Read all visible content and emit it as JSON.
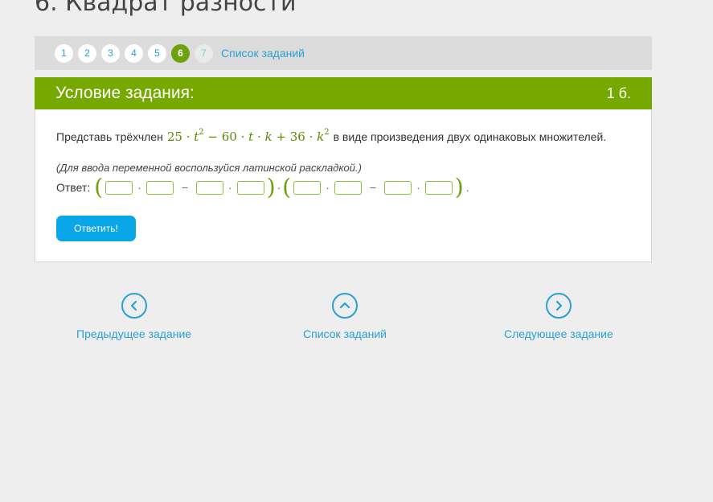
{
  "page": {
    "title": "6. Квадрат разности"
  },
  "pager": {
    "numbers": [
      "1",
      "2",
      "3",
      "4",
      "5",
      "6",
      "7"
    ],
    "active": "6",
    "list_link": "Список заданий"
  },
  "card": {
    "title": "Условие задания:",
    "points": "1 б.",
    "task_before": "Представь трёхчлен",
    "task_after": "в виде произведения двух одинаковых множителей.",
    "expression": {
      "c1": "25",
      "v1": "t",
      "e1": "2",
      "c2": "60",
      "v2": "t",
      "v3": "k",
      "c3": "36",
      "v4": "k",
      "e4": "2"
    },
    "hint": "(Для ввода переменной воспользуйся латинской раскладкой.)",
    "answer_label": "Ответ:",
    "submit_label": "Ответить!"
  },
  "navigation": {
    "prev": "Предыдущее задание",
    "list": "Список заданий",
    "next": "Следующее задание"
  },
  "colors": {
    "accent_green": "#76a900",
    "link_blue": "#2aa0d4",
    "button_blue": "#0aa7e8"
  }
}
